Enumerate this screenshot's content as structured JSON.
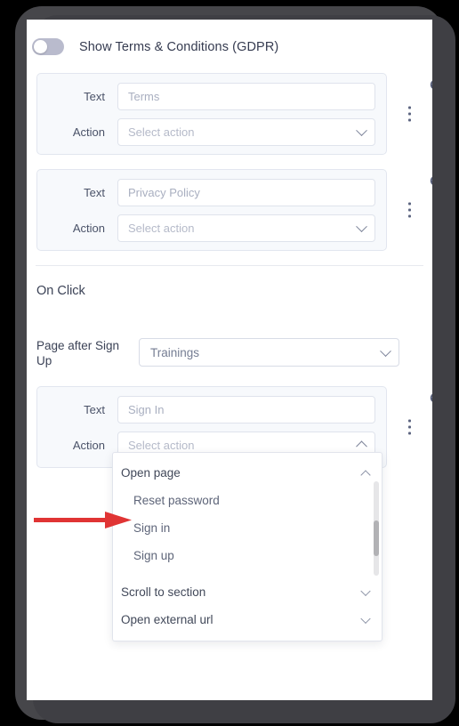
{
  "header": {
    "toggle_label": "Show Terms & Conditions (GDPR)",
    "toggle_state": "off"
  },
  "link_cards": [
    {
      "text_label": "Text",
      "text_value": "Terms",
      "action_label": "Action",
      "action_value": "Select action",
      "action_open": false,
      "kebab_icon": "vertical-dots-icon",
      "palette_icon": "palette-icon"
    },
    {
      "text_label": "Text",
      "text_value": "Privacy Policy",
      "action_label": "Action",
      "action_value": "Select action",
      "action_open": false,
      "kebab_icon": "vertical-dots-icon",
      "palette_icon": "palette-icon"
    },
    {
      "text_label": "Text",
      "text_value": "Sign In",
      "action_label": "Action",
      "action_value": "Select action",
      "action_open": true,
      "kebab_icon": "vertical-dots-icon",
      "palette_icon": "palette-icon"
    }
  ],
  "sections": {
    "on_click_title": "On Click",
    "page_after_signup_label": "Page after Sign Up",
    "page_after_signup_value": "Trainings"
  },
  "dropdown": {
    "items": [
      {
        "label": "Open page",
        "type": "group",
        "expanded": true
      },
      {
        "label": "Reset password",
        "type": "child"
      },
      {
        "label": "Sign in",
        "type": "child",
        "highlighted": true
      },
      {
        "label": "Sign up",
        "type": "child"
      },
      {
        "label": "Scroll to section",
        "type": "group",
        "expanded": false
      },
      {
        "label": "Open external url",
        "type": "group",
        "expanded": false
      }
    ],
    "scrollbar_visible": true
  },
  "annotation": {
    "arrow_icon": "red-arrow-right-icon",
    "arrow_color": "#e03434",
    "points_at": "Sign in"
  },
  "colors": {
    "frame": "#3f3f44",
    "screen": "#ffffff",
    "card_bg": "#f7f9fc",
    "text": "#3b4256",
    "placeholder": "#a9afc0",
    "accent_red": "#e03434"
  }
}
